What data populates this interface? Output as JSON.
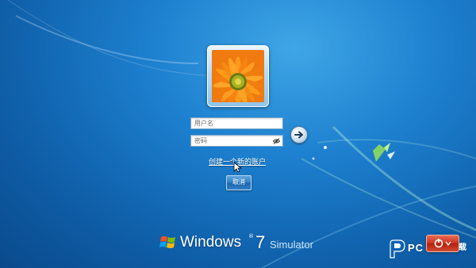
{
  "login": {
    "username_placeholder": "用户名",
    "password_placeholder": "密码",
    "create_account_link": "创建一个新的账户",
    "cancel_label": "取消",
    "submit_icon": "arrow-right-icon",
    "reveal_icon": "eye-icon",
    "avatar_icon": "orange-flower-avatar"
  },
  "branding": {
    "name": "Windows",
    "registered": "®",
    "version": "7",
    "suffix": "Simulator"
  },
  "watermark": {
    "text": "PC",
    "overlay_text": "载"
  },
  "colors": {
    "background": "#1d80cf",
    "power_button": "#c7331f",
    "cancel_button": "#2d7dc4"
  }
}
